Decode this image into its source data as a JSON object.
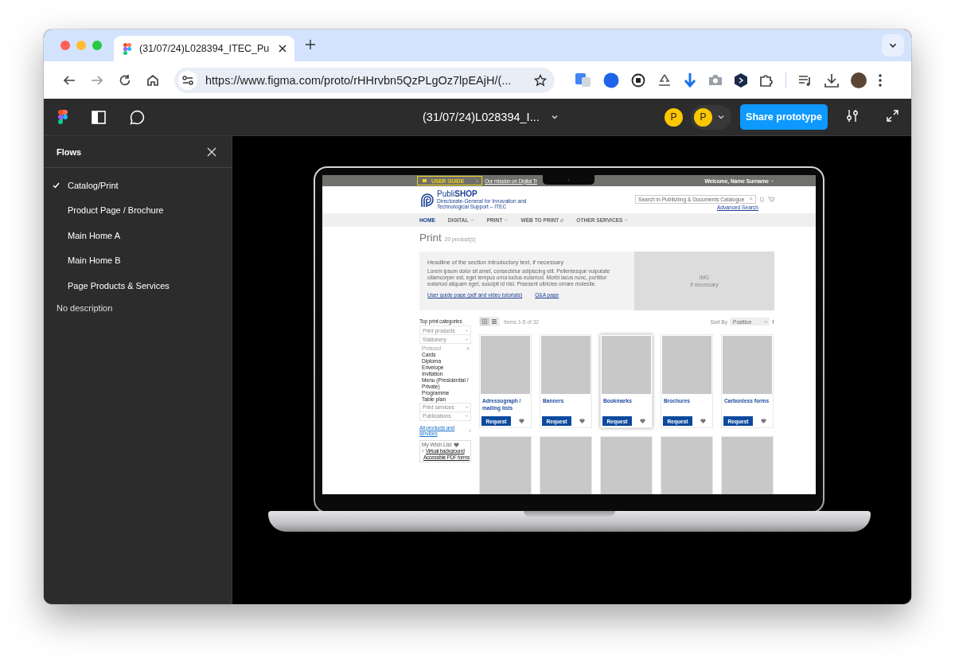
{
  "browser": {
    "tabs": [
      {
        "title": "(31/07/24)L028394_ITEC_Pu",
        "selected": true
      }
    ],
    "url": "https://www.figma.com/proto/rHHrvbn5QzPLgOz7lpEAjH/(..."
  },
  "figma_toolbar": {
    "file_title": "(31/07/24)L028394_I...",
    "avatars": [
      {
        "initial": "P"
      },
      {
        "initial": "P"
      }
    ],
    "share_button": "Share prototype"
  },
  "flows_panel": {
    "title": "Flows",
    "flows": [
      {
        "label": "Catalog/Print",
        "selected": true
      },
      {
        "label": "Product Page / Brochure",
        "selected": false
      },
      {
        "label": "Main Home A",
        "selected": false
      },
      {
        "label": "Main Home B",
        "selected": false
      },
      {
        "label": "Page Products & Services",
        "selected": false
      }
    ],
    "description": "No description"
  },
  "shop": {
    "top_bar": {
      "user_guide": "USER GUIDE",
      "mission_link": "Our mission on Digital Tr",
      "welcome": "Welcome, Name Surname"
    },
    "logo": {
      "name": "Publi**SHOP**",
      "subtitle": "Directorate-General for Innovation and Technological Support – ITEC"
    },
    "search": {
      "placeholder": "Search in Publishing & Documents Catalogue"
    },
    "advanced_search": "Advanced Search",
    "nav": [
      {
        "label": "HOME",
        "kind": "link",
        "selected": true
      },
      {
        "label": "DIGITAL",
        "kind": "dropdown",
        "selected": false
      },
      {
        "label": "PRINT",
        "kind": "dropdown",
        "selected": false
      },
      {
        "label": "WEB TO PRINT",
        "kind": "external",
        "selected": false
      },
      {
        "label": "OTHER SERVICES",
        "kind": "dropdown",
        "selected": false
      }
    ],
    "page_title": "Print",
    "product_count": "20 product(s)",
    "intro": {
      "headline": "Headline of the section introductory text, if necessary",
      "body": "Lorem ipsum dolor sit amet, consectetur adipiscing elit. Pellentesque vulputate ullamcorper est, eget tempus urna luctus euismod. Morbi iacus nunc, porttitor euismod aliquam eget, suscipit id nisl. Praesent ultricies ornare molestie.",
      "links": [
        "User guide page (pdf and video tutorials)",
        "Q&A page"
      ],
      "image_label": "IMG",
      "image_note": "if necessary"
    },
    "categories": {
      "title": "Top print categories",
      "groups": [
        {
          "label": "Print products",
          "expanded": false
        },
        {
          "label": "Stationery",
          "expanded": false
        },
        {
          "label": "Protocol",
          "expanded": true,
          "children": [
            {
              "label": "Cards"
            },
            {
              "label": "Diploma"
            },
            {
              "label": "Envelope"
            },
            {
              "label": "Invitation"
            },
            {
              "label": "Menu (Presidential / Private)"
            },
            {
              "label": "Programme"
            },
            {
              "label": "Table plan"
            }
          ]
        },
        {
          "label": "Print services",
          "expanded": false
        },
        {
          "label": "Publications",
          "expanded": false
        }
      ],
      "all_link": "All products and services"
    },
    "wish_list": {
      "title": "My Wish List",
      "items": [
        "Virtual background",
        "Accessible PDF forms"
      ]
    },
    "listing": {
      "views": [
        {
          "kind": "grid",
          "selected": true
        },
        {
          "kind": "list",
          "selected": false
        }
      ],
      "items_count": "Items 1-5 of 32",
      "sort_label": "Sort By",
      "sort_value": "Position"
    },
    "products": [
      {
        "title": "Adressograph / mailing lists",
        "button": "Request",
        "hovered": false
      },
      {
        "title": "Banners",
        "button": "Request",
        "hovered": false
      },
      {
        "title": "Bookmarks",
        "button": "Request",
        "hovered": true
      },
      {
        "title": "Brochures",
        "button": "Request",
        "hovered": false
      },
      {
        "title": "Carbonless forms",
        "button": "Request",
        "hovered": false
      }
    ],
    "more_products": [
      {
        "kind": "placeholder"
      },
      {
        "kind": "placeholder"
      },
      {
        "kind": "placeholder"
      },
      {
        "kind": "placeholder"
      },
      {
        "kind": "placeholder"
      }
    ]
  }
}
